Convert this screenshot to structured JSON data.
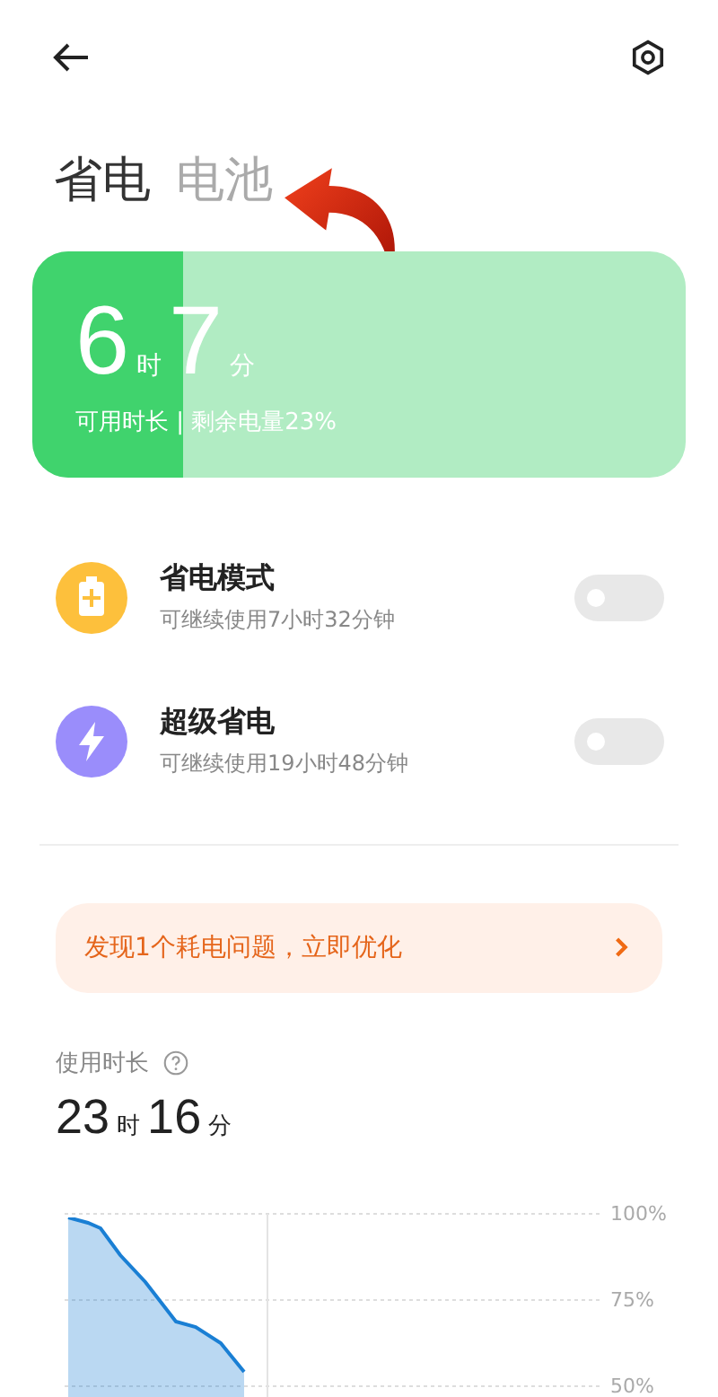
{
  "header": {
    "tabs": [
      {
        "label": "省电",
        "selected": true
      },
      {
        "label": "电池",
        "selected": false
      }
    ]
  },
  "battery": {
    "level": 0.23,
    "hours": "6",
    "hours_unit": "时",
    "minutes": "7",
    "minutes_unit": "分",
    "caption": "可用时长 | 剩余电量23%"
  },
  "modes": [
    {
      "kind": "battery",
      "title": "省电模式",
      "subtitle": "可继续使用7小时32分钟",
      "on": false,
      "color": "#fdc03c"
    },
    {
      "kind": "bolt",
      "title": "超级省电",
      "subtitle": "可继续使用19小时48分钟",
      "on": false,
      "color": "#9a8dfb"
    }
  ],
  "alert": {
    "text": "发现1个耗电问题，立即优化"
  },
  "usage": {
    "label": "使用时长",
    "hours": "23",
    "hours_unit": "时",
    "minutes": "16",
    "minutes_unit": "分",
    "axis_labels": [
      "100%",
      "75%",
      "50%"
    ]
  }
}
